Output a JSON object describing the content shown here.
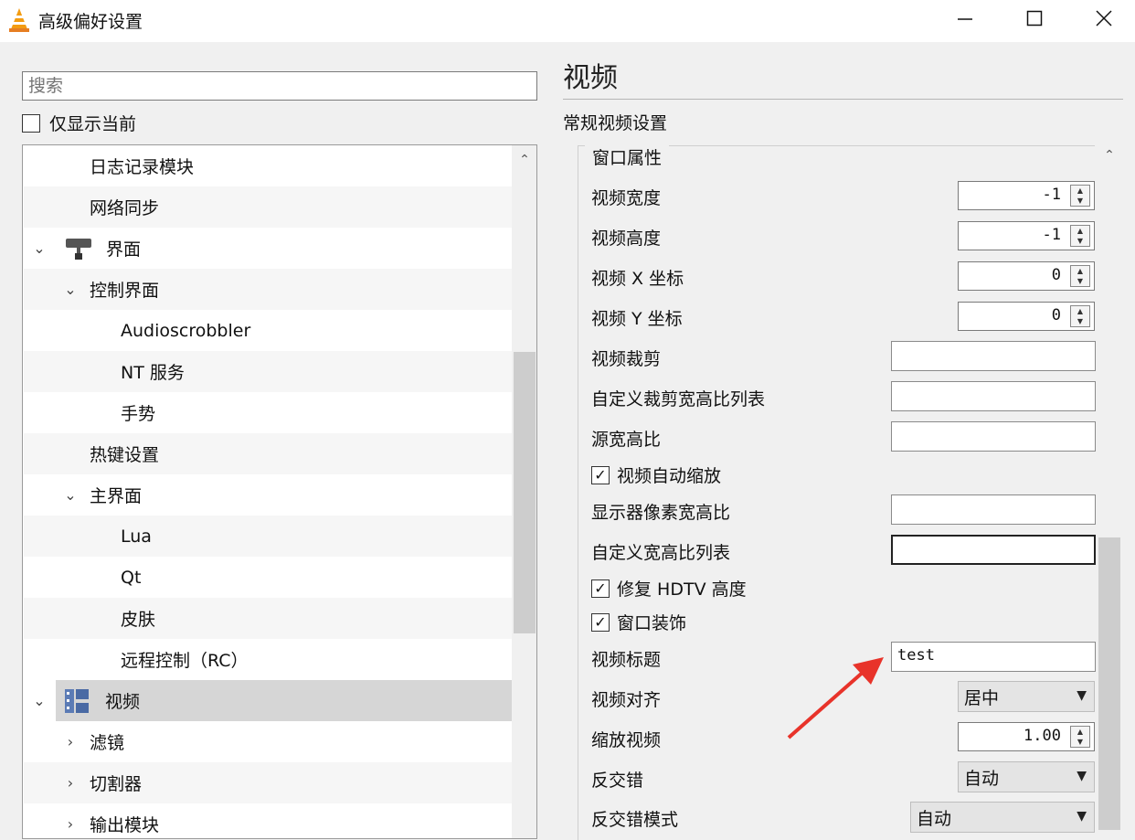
{
  "window": {
    "title": "高级偏好设置",
    "app_icon": "vlc-cone-icon",
    "controls": [
      "minimize-icon",
      "maximize-icon",
      "close-icon"
    ]
  },
  "sidebar": {
    "search_placeholder": "搜索",
    "only_current_label": "仅显示当前",
    "only_current_checked": false,
    "tree": [
      {
        "label": "日志记录模块",
        "level": 1,
        "expanded": null,
        "icon": null,
        "selected": false
      },
      {
        "label": "网络同步",
        "level": 1,
        "expanded": null,
        "icon": null,
        "selected": false
      },
      {
        "label": "界面",
        "level": 0,
        "expanded": true,
        "icon": "paint-roller-icon",
        "selected": false
      },
      {
        "label": "控制界面",
        "level": 1,
        "expanded": true,
        "icon": null,
        "selected": false
      },
      {
        "label": "Audioscrobbler",
        "level": 2,
        "expanded": null,
        "icon": null,
        "selected": false
      },
      {
        "label": "NT 服务",
        "level": 2,
        "expanded": null,
        "icon": null,
        "selected": false
      },
      {
        "label": "手势",
        "level": 2,
        "expanded": null,
        "icon": null,
        "selected": false
      },
      {
        "label": "热键设置",
        "level": 1,
        "expanded": null,
        "icon": null,
        "selected": false
      },
      {
        "label": "主界面",
        "level": 1,
        "expanded": true,
        "icon": null,
        "selected": false
      },
      {
        "label": "Lua",
        "level": 2,
        "expanded": null,
        "icon": null,
        "selected": false
      },
      {
        "label": "Qt",
        "level": 2,
        "expanded": null,
        "icon": null,
        "selected": false
      },
      {
        "label": "皮肤",
        "level": 2,
        "expanded": null,
        "icon": null,
        "selected": false
      },
      {
        "label": "远程控制（RC）",
        "level": 2,
        "expanded": null,
        "icon": null,
        "selected": false
      },
      {
        "label": "视频",
        "level": 0,
        "expanded": true,
        "icon": "film-icon",
        "selected": true
      },
      {
        "label": "滤镜",
        "level": 1,
        "expanded": false,
        "icon": null,
        "selected": false
      },
      {
        "label": "切割器",
        "level": 1,
        "expanded": false,
        "icon": null,
        "selected": false
      },
      {
        "label": "输出模块",
        "level": 1,
        "expanded": false,
        "icon": null,
        "selected": false
      }
    ]
  },
  "main": {
    "section_title": "视频",
    "subsection": "常规视频设置",
    "group_title": "窗口属性",
    "options": {
      "video_width": {
        "label": "视频宽度",
        "value": "-1"
      },
      "video_height": {
        "label": "视频高度",
        "value": "-1"
      },
      "video_x": {
        "label": "视频 X 坐标",
        "value": "0"
      },
      "video_y": {
        "label": "视频 Y 坐标",
        "value": "0"
      },
      "video_crop": {
        "label": "视频裁剪",
        "value": ""
      },
      "custom_crop_ratios": {
        "label": "自定义裁剪宽高比列表",
        "value": ""
      },
      "source_aspect": {
        "label": "源宽高比",
        "value": ""
      },
      "autoscale": {
        "label": "视频自动缩放",
        "checked": true
      },
      "monitor_pixel_aspect": {
        "label": "显示器像素宽高比",
        "value": ""
      },
      "custom_aspect_ratios": {
        "label": "自定义宽高比列表",
        "value": ""
      },
      "fix_hdtv": {
        "label": "修复 HDTV 高度",
        "checked": true
      },
      "window_decorations": {
        "label": "窗口装饰",
        "checked": true
      },
      "video_title": {
        "label": "视频标题",
        "value": "test"
      },
      "video_align": {
        "label": "视频对齐",
        "value": "居中"
      },
      "zoom": {
        "label": "缩放视频",
        "value": "1.00"
      },
      "deinterlace": {
        "label": "反交错",
        "value": "自动"
      },
      "deinterlace_mode": {
        "label": "反交错模式",
        "value": "自动"
      }
    }
  },
  "annotation": {
    "type": "red-arrow",
    "color": "#e8332a",
    "points_to": "video_title"
  }
}
